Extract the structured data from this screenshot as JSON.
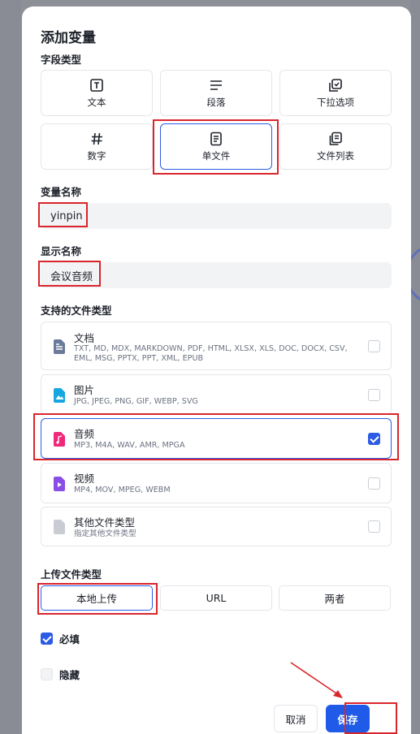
{
  "dialog": {
    "title": "添加变量",
    "field_type_label": "字段类型",
    "field_types": [
      {
        "label": "文本",
        "icon": "text-icon"
      },
      {
        "label": "段落",
        "icon": "paragraph-icon"
      },
      {
        "label": "下拉选项",
        "icon": "select-icon"
      },
      {
        "label": "数字",
        "icon": "hash-icon"
      },
      {
        "label": "单文件",
        "icon": "file-icon",
        "selected": true
      },
      {
        "label": "文件列表",
        "icon": "files-icon"
      }
    ],
    "var_name_label": "变量名称",
    "var_name_value": "yinpin",
    "display_name_label": "显示名称",
    "display_name_value": "会议音频",
    "file_types_label": "支持的文件类型",
    "file_types": [
      {
        "name": "文档",
        "desc": "TXT, MD, MDX, MARKDOWN, PDF, HTML, XLSX, XLS, DOC, DOCX, CSV, EML, MSG, PPTX, PPT, XML, EPUB",
        "checked": false,
        "color": "#6b7a99"
      },
      {
        "name": "图片",
        "desc": "JPG, JPEG, PNG, GIF, WEBP, SVG",
        "checked": false,
        "color": "#17a7e0"
      },
      {
        "name": "音频",
        "desc": "MP3, M4A, WAV, AMR, MPGA",
        "checked": true,
        "color": "#f0287a"
      },
      {
        "name": "视频",
        "desc": "MP4, MOV, MPEG, WEBM",
        "checked": false,
        "color": "#8a4ee6"
      },
      {
        "name": "其他文件类型",
        "desc": "指定其他文件类型",
        "checked": false,
        "color": "#c9ccd3"
      }
    ],
    "upload_type_label": "上传文件类型",
    "upload_types": [
      "本地上传",
      "URL",
      "两者"
    ],
    "required_label": "必填",
    "required_checked": true,
    "hidden_label": "隐藏",
    "hidden_checked": false,
    "cancel_label": "取消",
    "save_label": "保存"
  },
  "colors": {
    "accent": "#2c5ce5",
    "highlight": "#d9252b"
  }
}
